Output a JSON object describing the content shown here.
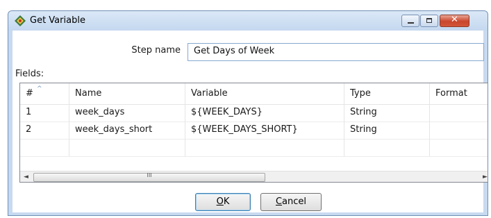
{
  "window": {
    "title": "Get Variable",
    "icons": {
      "app": "pentaho-step-icon",
      "minimize": "minimize-icon",
      "maximize": "maximize-icon",
      "close": "close-icon"
    },
    "close_glyph": "✕"
  },
  "step": {
    "label": "Step name",
    "value": "Get Days of Week"
  },
  "fields": {
    "label": "Fields:",
    "columns": [
      "#",
      "Name",
      "Variable",
      "Type",
      "Format"
    ],
    "rows": [
      {
        "num": "1",
        "name": "week_days",
        "variable": "${WEEK_DAYS}",
        "type": "String",
        "format": ""
      },
      {
        "num": "2",
        "name": "week_days_short",
        "variable": "${WEEK_DAYS_SHORT}",
        "type": "String",
        "format": ""
      },
      {
        "num": "",
        "name": "",
        "variable": "",
        "type": "",
        "format": ""
      }
    ],
    "scroll_grip": "III",
    "scroll_left": "◄",
    "scroll_right": "►"
  },
  "buttons": {
    "ok_key": "O",
    "ok_rest": "K",
    "cancel_key": "C",
    "cancel_rest": "ancel"
  },
  "colors": {
    "title_gradient": [
      "#dbe8f7",
      "#c4d8ef"
    ],
    "close_button": "#c9462c",
    "input_border": "#86a9cf"
  }
}
